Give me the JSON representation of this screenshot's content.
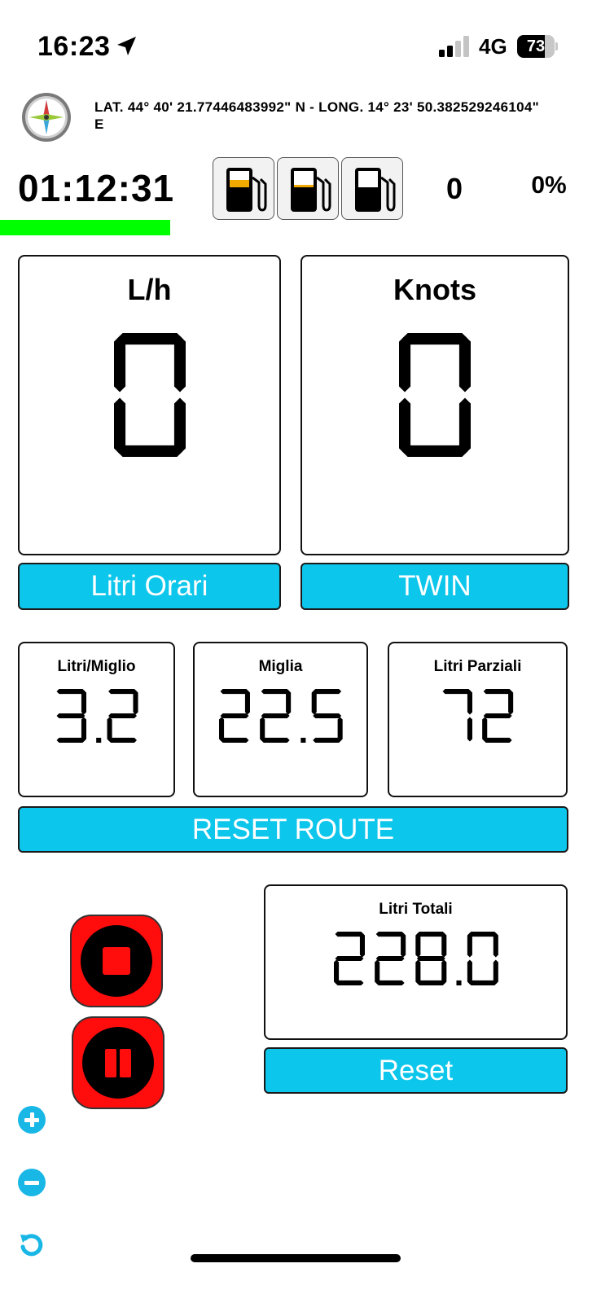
{
  "status_bar": {
    "time": "16:23",
    "network": "4G",
    "battery": "73",
    "battery_level": 0.73
  },
  "gps": {
    "coordinates": "LAT. 44° 40' 21.77446483992\" N - LONG. 14° 23' 50.382529246104\" E"
  },
  "timer": {
    "elapsed": "01:12:31"
  },
  "fuel_tanks": [
    {
      "name": "tank-1",
      "fill_level": 0.45
    },
    {
      "name": "tank-2",
      "fill_level": 0.15
    },
    {
      "name": "tank-3",
      "fill_level": 0.0
    }
  ],
  "counter": "0",
  "percent": "0%",
  "gauges": {
    "lh": {
      "title": "L/h",
      "value": "0"
    },
    "knots": {
      "title": "Knots",
      "value": "0"
    }
  },
  "buttons": {
    "litri_orari": "Litri Orari",
    "twin": "TWIN",
    "reset_route": "RESET ROUTE",
    "reset": "Reset"
  },
  "stats": {
    "litri_miglio": {
      "title": "Litri/Miglio",
      "value": "3.2"
    },
    "miglia": {
      "title": "Miglia",
      "value": "22.5"
    },
    "litri_parziali": {
      "title": "Litri Parziali",
      "value": "72"
    }
  },
  "totals": {
    "title": "Litri Totali",
    "value": "228.0"
  },
  "colors": {
    "accent": "#0dc6eb",
    "record_red": "#ff0d0d",
    "progress_green": "#00ff00",
    "fuel_orange": "#f2a900"
  },
  "icons": [
    "location-arrow-icon",
    "compass-icon",
    "fuel-pump-icon",
    "stop-icon",
    "pause-icon",
    "zoom-in-icon",
    "zoom-out-icon",
    "refresh-icon"
  ]
}
